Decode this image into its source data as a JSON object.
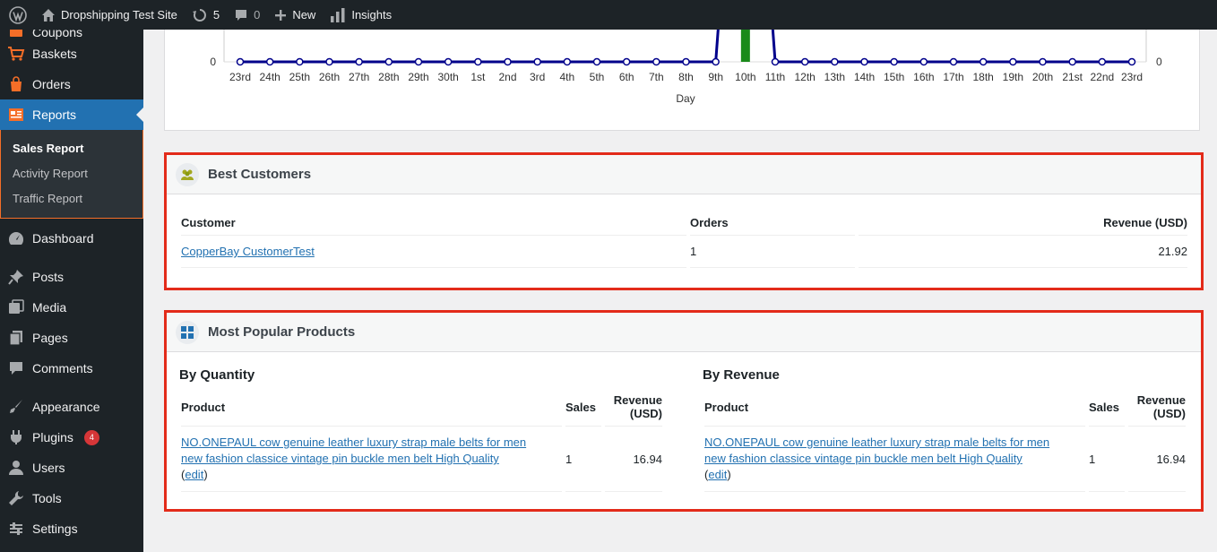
{
  "adminbar": {
    "site_name": "Dropshipping Test Site",
    "updates_count": "5",
    "comments_count": "0",
    "new_label": "New",
    "insights_label": "Insights"
  },
  "sidebar": {
    "items_top": [
      {
        "label": "Coupons",
        "icon": "coupons-icon"
      },
      {
        "label": "Baskets",
        "icon": "basket-icon"
      },
      {
        "label": "Orders",
        "icon": "orders-icon"
      },
      {
        "label": "Reports",
        "icon": "reports-icon"
      }
    ],
    "submenu": [
      {
        "label": "Sales Report",
        "active": true
      },
      {
        "label": "Activity Report",
        "active": false
      },
      {
        "label": "Traffic Report",
        "active": false
      }
    ],
    "items_bottom": [
      {
        "label": "Dashboard",
        "icon": "dashboard-icon"
      },
      {
        "label": "Posts",
        "icon": "pin-icon"
      },
      {
        "label": "Media",
        "icon": "media-icon"
      },
      {
        "label": "Pages",
        "icon": "pages-icon"
      },
      {
        "label": "Comments",
        "icon": "comment-icon"
      },
      {
        "label": "Appearance",
        "icon": "brush-icon"
      },
      {
        "label": "Plugins",
        "icon": "plugin-icon",
        "badge": "4"
      },
      {
        "label": "Users",
        "icon": "user-icon"
      },
      {
        "label": "Tools",
        "icon": "wrench-icon"
      },
      {
        "label": "Settings",
        "icon": "settings-icon"
      }
    ]
  },
  "chart_data": {
    "type": "line",
    "xlabel": "Day",
    "ylabel": "",
    "x": [
      "23rd",
      "24th",
      "25th",
      "26th",
      "27th",
      "28th",
      "29th",
      "30th",
      "1st",
      "2nd",
      "3rd",
      "4th",
      "5th",
      "6th",
      "7th",
      "8th",
      "9th",
      "10th",
      "11th",
      "12th",
      "13th",
      "14th",
      "15th",
      "16th",
      "17th",
      "18th",
      "19th",
      "20th",
      "21st",
      "22nd",
      "23rd"
    ],
    "series": [
      {
        "values": [
          0,
          0,
          0,
          0,
          0,
          0,
          0,
          0,
          0,
          0,
          0,
          0,
          0,
          0,
          0,
          0,
          0,
          1,
          0,
          0,
          0,
          0,
          0,
          0,
          0,
          0,
          0,
          0,
          0,
          0,
          0
        ],
        "color": "#00008b"
      }
    ],
    "bars": {
      "category": "10th",
      "color": "#1a8a1a"
    },
    "y_left_tick": "0",
    "y_right_tick": "0"
  },
  "best_customers": {
    "title": "Best Customers",
    "headers": {
      "customer": "Customer",
      "orders": "Orders",
      "revenue": "Revenue (USD)"
    },
    "rows": [
      {
        "customer": "CopperBay CustomerTest",
        "orders": "1",
        "revenue": "21.92"
      }
    ]
  },
  "popular_products": {
    "title": "Most Popular Products",
    "by_quantity": {
      "title": "By Quantity",
      "headers": {
        "product": "Product",
        "sales": "Sales",
        "revenue_line1": "Revenue",
        "revenue_line2": "(USD)"
      },
      "rows": [
        {
          "product_line1": "NO.ONEPAUL cow genuine leather luxury strap male belts for men",
          "product_line2": "new fashion classice vintage pin buckle men belt High Quality",
          "edit_prefix": "(",
          "edit": "edit",
          "edit_suffix": ")",
          "sales": "1",
          "revenue": "16.94"
        }
      ]
    },
    "by_revenue": {
      "title": "By Revenue",
      "headers": {
        "product": "Product",
        "sales": "Sales",
        "revenue_line1": "Revenue",
        "revenue_line2": "(USD)"
      },
      "rows": [
        {
          "product_line1": "NO.ONEPAUL cow genuine leather luxury strap male belts for men",
          "product_line2": "new fashion classice vintage pin buckle men belt High Quality",
          "edit_prefix": "(",
          "edit": "edit",
          "edit_suffix": ")",
          "sales": "1",
          "revenue": "16.94"
        }
      ]
    }
  }
}
